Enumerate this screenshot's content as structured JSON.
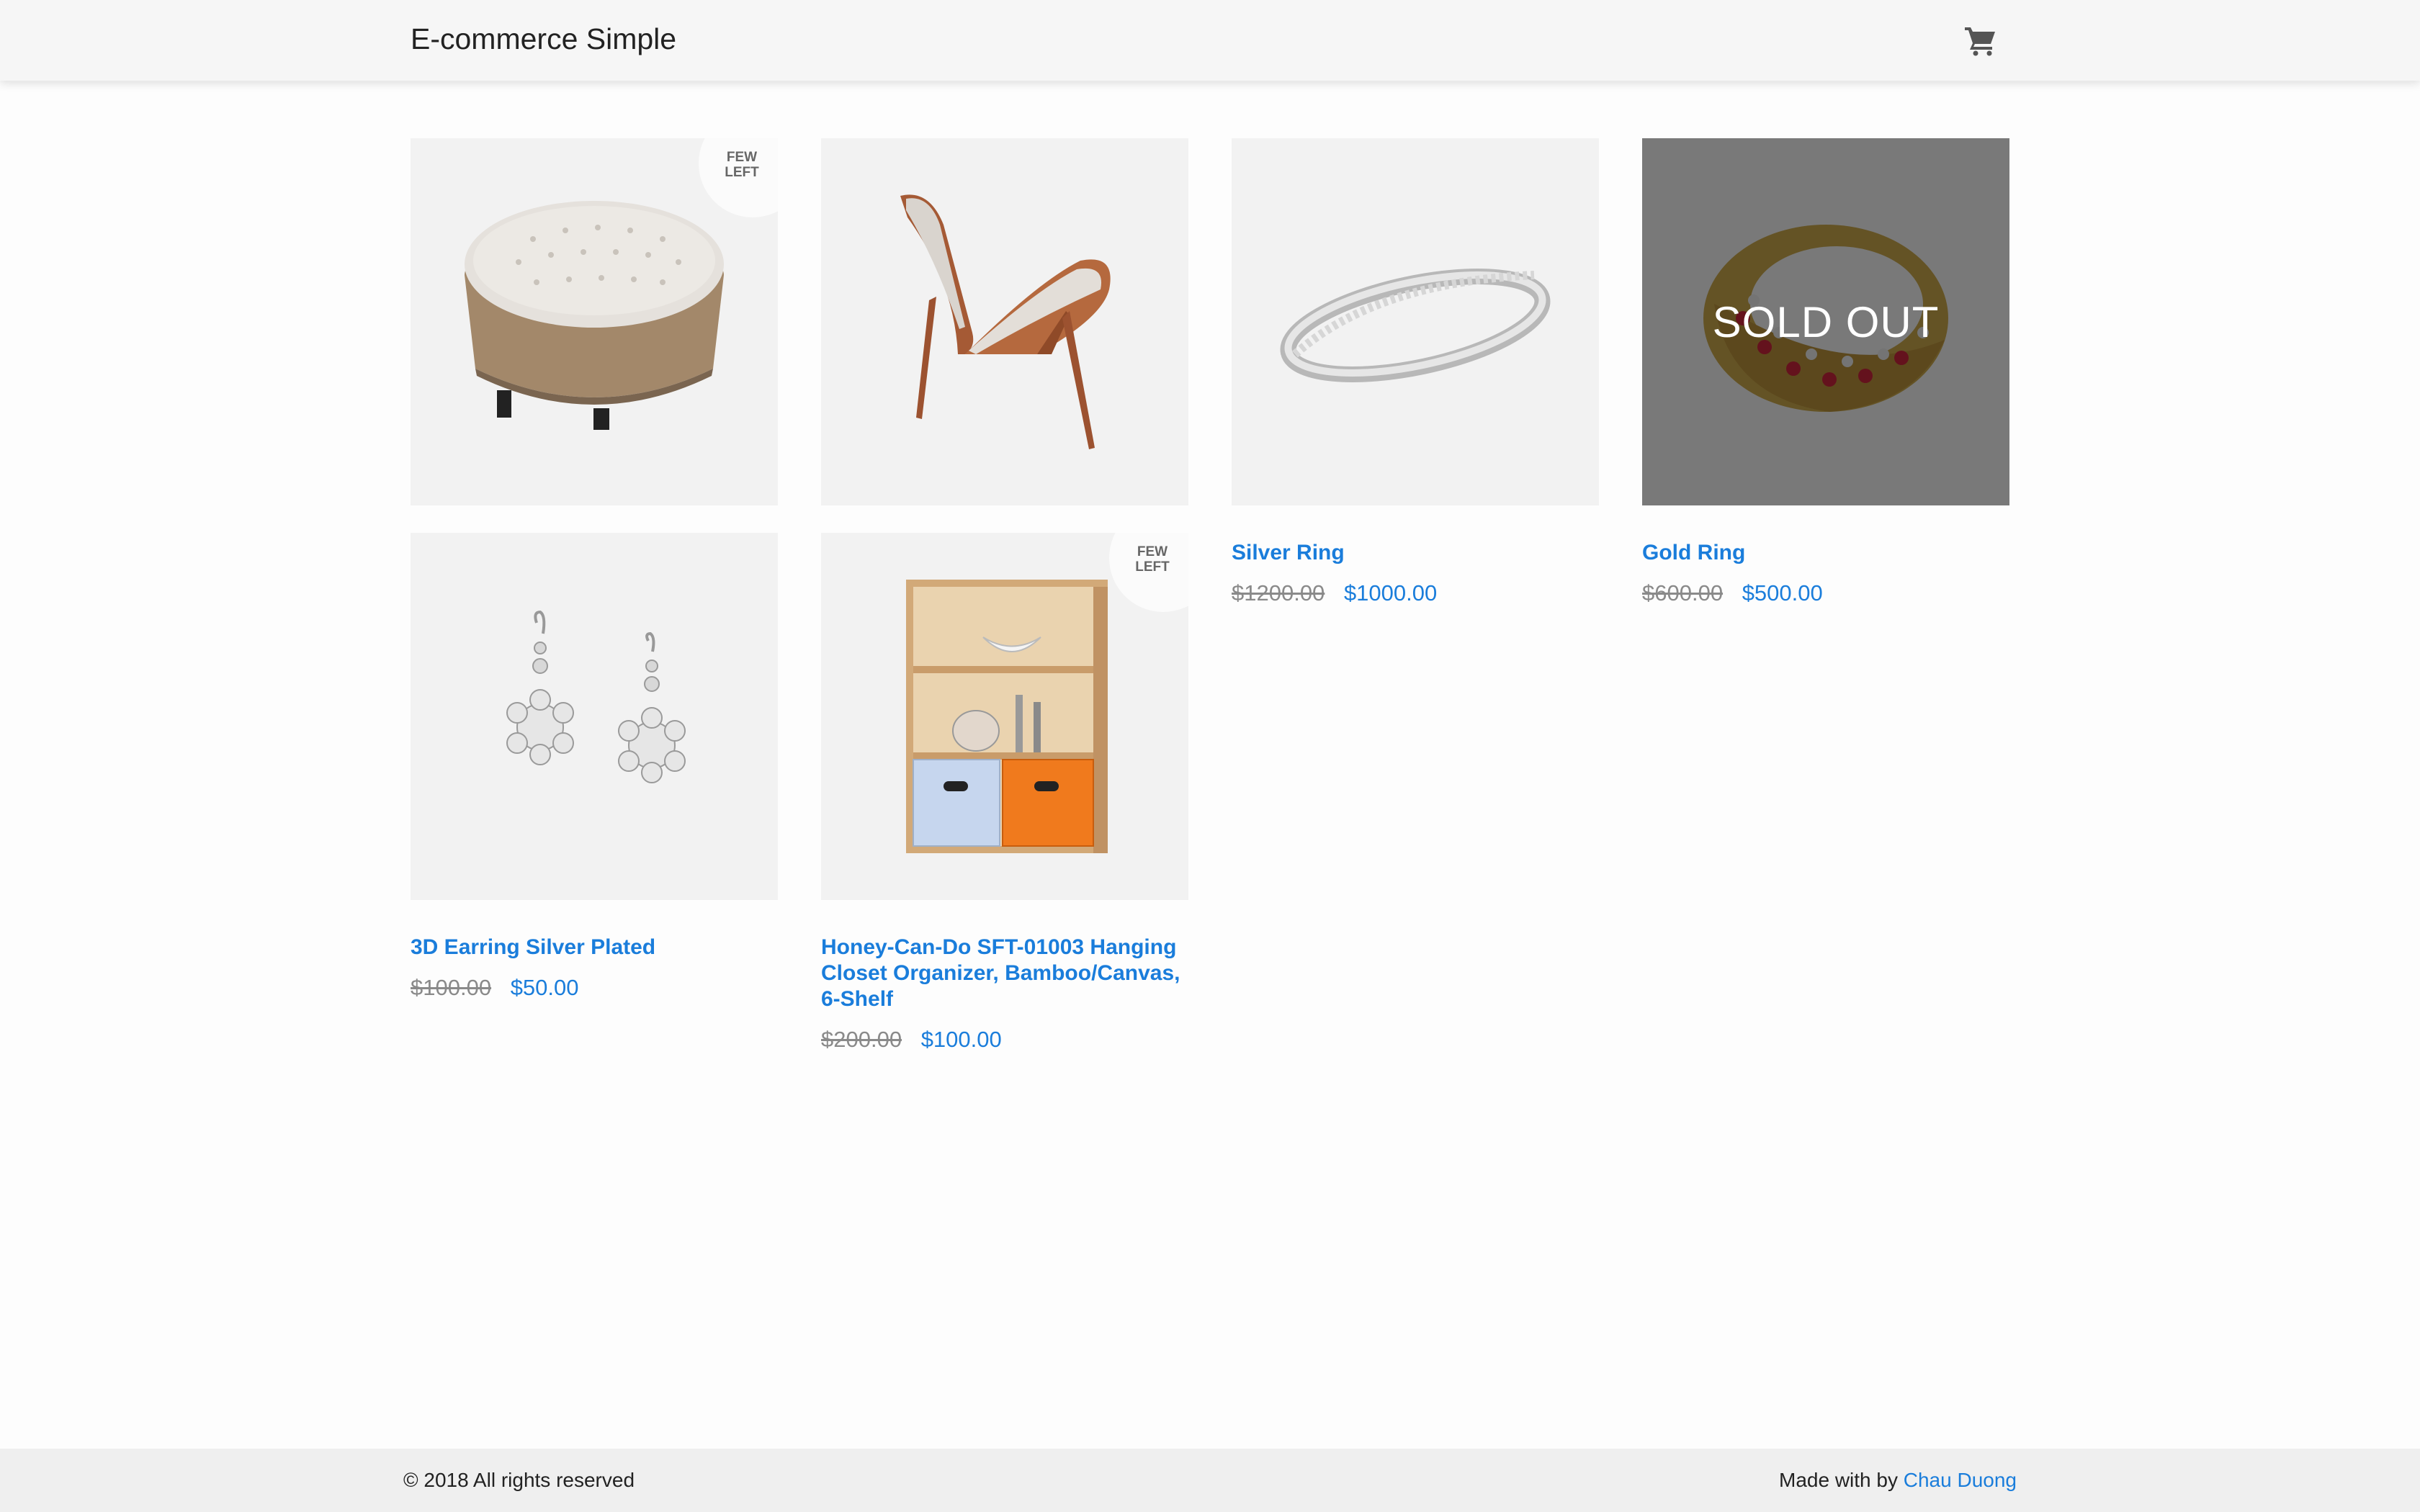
{
  "header": {
    "brand": "E-commerce Simple",
    "cart_icon": "cart-icon"
  },
  "badges": {
    "few_left_line1": "FEW",
    "few_left_line2": "LEFT",
    "sold_out": "SOLD OUT"
  },
  "products": [
    {
      "name": "",
      "old_price": "",
      "price": "",
      "image": "ottoman-image",
      "status": "few-left"
    },
    {
      "name": "",
      "old_price": "",
      "price": "",
      "image": "lounge-chair-image",
      "status": "in-stock"
    },
    {
      "name": "Silver Ring",
      "old_price": "$1200.00",
      "price": "$1000.00",
      "image": "silver-ring-image",
      "status": "in-stock"
    },
    {
      "name": "Gold Ring",
      "old_price": "$600.00",
      "price": "$500.00",
      "image": "gold-ring-image",
      "status": "sold-out"
    },
    {
      "name": "3D Earring Silver Plated",
      "old_price": "$100.00",
      "price": "$50.00",
      "image": "earrings-image",
      "status": "in-stock"
    },
    {
      "name": "Honey-Can-Do SFT-01003 Hanging Closet Organizer, Bamboo/Canvas, 6-Shelf",
      "old_price": "$200.00",
      "price": "$100.00",
      "image": "shelf-organizer-image",
      "status": "few-left"
    }
  ],
  "footer": {
    "copyright": "© 2018 All rights reserved",
    "made_with": "Made with by",
    "author": "Chau Duong"
  },
  "colors": {
    "accent": "#1a7ddb",
    "header_bg": "#f6f6f6",
    "footer_bg": "#efefef",
    "thumb_bg": "#f2f2f2"
  }
}
